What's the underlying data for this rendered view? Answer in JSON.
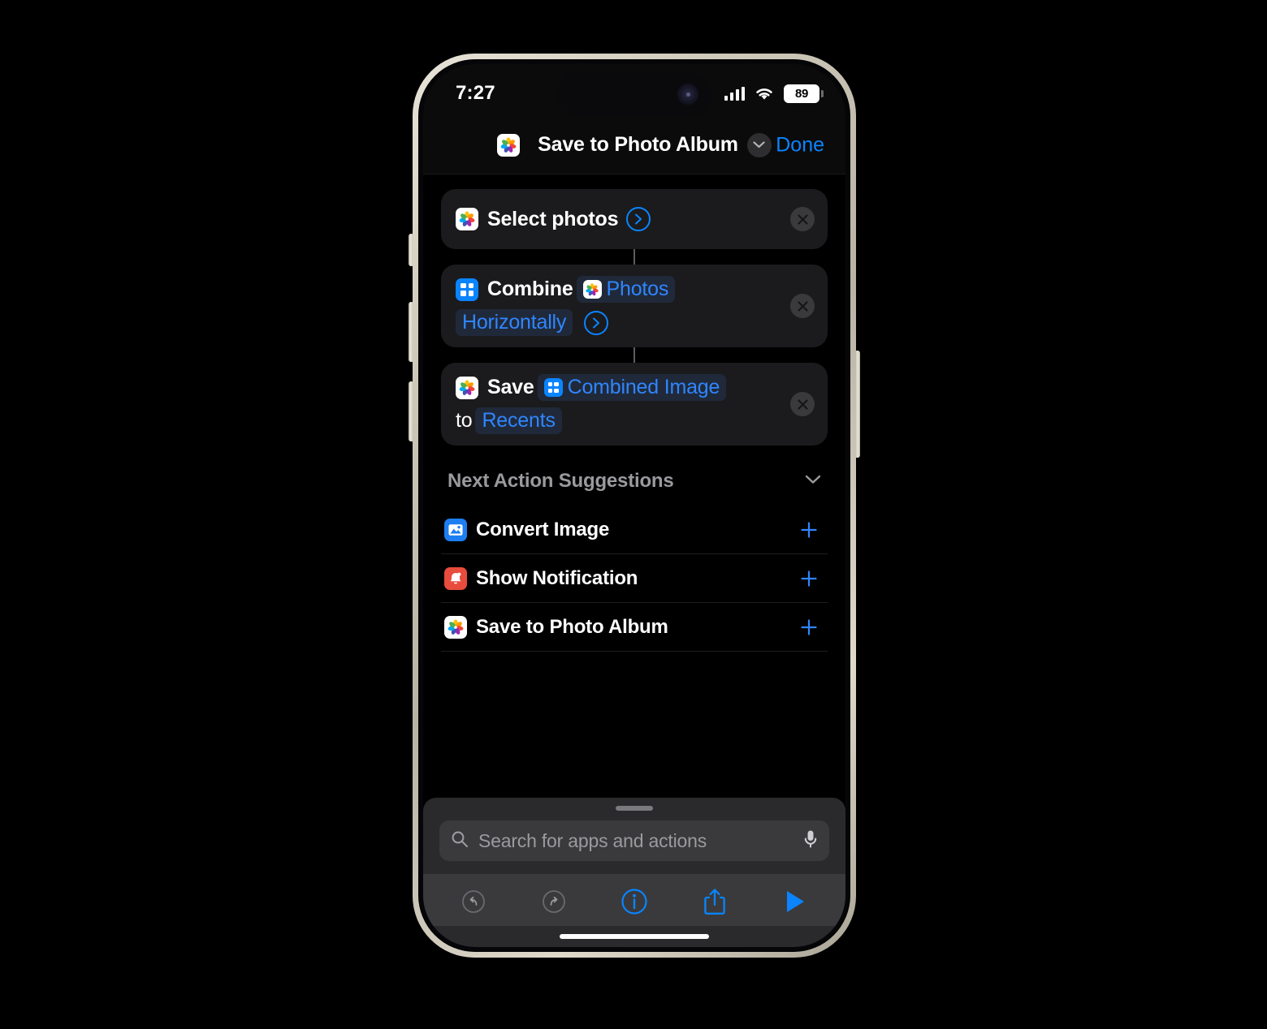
{
  "status_bar": {
    "time": "7:27",
    "cellular_icon": "cellular-bars-icon",
    "wifi_icon": "wifi-icon",
    "battery_percent": "89"
  },
  "nav_bar": {
    "app_icon": "photos-app-icon",
    "title": "Save to Photo Album",
    "chevron_icon": "chevron-down-icon",
    "done_label": "Done"
  },
  "actions": [
    {
      "id": "select-photos",
      "icon": "photos-app-icon",
      "tokens": [
        {
          "type": "text",
          "value": "Select photos"
        },
        {
          "type": "disclosure",
          "value": "chevron-right-icon"
        }
      ],
      "remove_icon": "close-icon"
    },
    {
      "id": "combine-images",
      "icon": "grid-app-icon",
      "line1": [
        {
          "type": "text",
          "value": "Combine"
        },
        {
          "type": "pill",
          "value": "Photos",
          "pill_icon": "photos-app-icon"
        }
      ],
      "line2": [
        {
          "type": "pill",
          "value": "Horizontally",
          "pill_icon": null
        },
        {
          "type": "disclosure",
          "value": "chevron-right-icon"
        }
      ],
      "remove_icon": "close-icon"
    },
    {
      "id": "save-to-photo-album",
      "icon": "photos-app-icon",
      "line1": [
        {
          "type": "text",
          "value": "Save"
        },
        {
          "type": "pill",
          "value": "Combined Image",
          "pill_icon": "grid-app-icon"
        }
      ],
      "line2": [
        {
          "type": "text",
          "value": "to"
        },
        {
          "type": "pill",
          "value": "Recents",
          "pill_icon": null
        }
      ],
      "remove_icon": "close-icon"
    }
  ],
  "suggestions_section": {
    "title": "Next Action Suggestions",
    "collapse_icon": "chevron-down-icon",
    "items": [
      {
        "label": "Convert Image",
        "icon": "image-convert-icon",
        "icon_color": "#1c7ef0",
        "add_icon": "plus-icon"
      },
      {
        "label": "Show Notification",
        "icon": "bell-icon",
        "icon_color": "#e84c3d",
        "add_icon": "plus-icon"
      },
      {
        "label": "Save to Photo Album",
        "icon": "photos-app-icon",
        "icon_color": "#ffffff",
        "add_icon": "plus-icon"
      }
    ]
  },
  "bottom": {
    "search": {
      "placeholder": "Search for apps and actions",
      "search_icon": "search-icon",
      "mic_icon": "microphone-icon"
    },
    "toolbar": [
      {
        "name": "undo-button",
        "icon": "undo-icon",
        "enabled": "false"
      },
      {
        "name": "redo-button",
        "icon": "redo-icon",
        "enabled": "false"
      },
      {
        "name": "info-button",
        "icon": "info-circle-icon",
        "enabled": "true"
      },
      {
        "name": "share-button",
        "icon": "share-icon",
        "enabled": "true"
      },
      {
        "name": "run-button",
        "icon": "play-icon",
        "enabled": "true"
      }
    ]
  },
  "colors": {
    "accent_blue": "#0a84ff",
    "variable_blue": "#2f86ff",
    "card_bg": "#1b1b1d",
    "page_bg": "#000000",
    "bottom_bg": "#3a3a3c",
    "notification_red": "#e84c3d"
  }
}
